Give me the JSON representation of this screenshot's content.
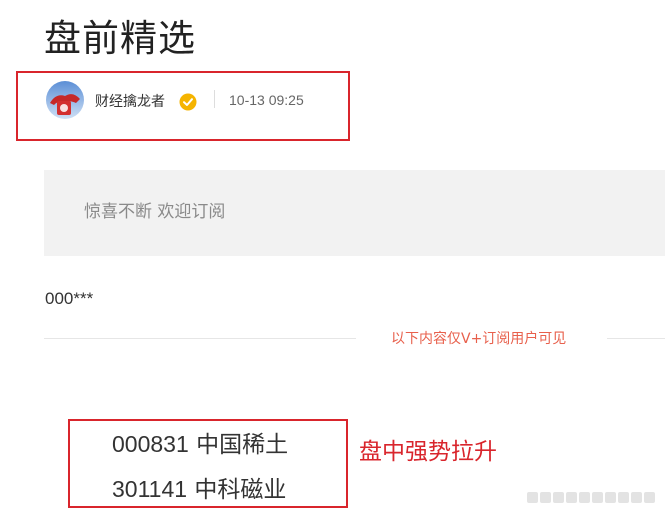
{
  "article": {
    "title": "盘前精选"
  },
  "author": {
    "name": "财经擒龙者",
    "verified_icon": "verified-badge-icon",
    "time": "10-13 09:25",
    "avatar_icon": "avatar-image"
  },
  "banner": {
    "text": "惊喜不断 欢迎订阅"
  },
  "content": {
    "code_line": "000***",
    "subscriber_note": "以下内容仅V+订阅用户可见"
  },
  "stocks": [
    {
      "code": "000831",
      "name": "中国稀土"
    },
    {
      "code": "301141",
      "name": "中科磁业"
    }
  ],
  "annotation": {
    "text": "盘中强势拉升"
  },
  "colors": {
    "highlight_red": "#d9252c",
    "note_orange": "#e8604c",
    "verified_gold": "#f5b400",
    "banner_bg": "#f2f2f2"
  }
}
